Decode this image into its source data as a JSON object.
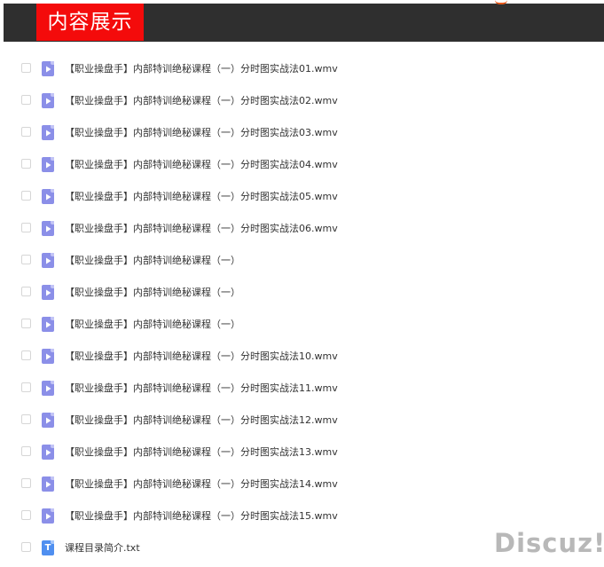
{
  "header": {
    "title": "内容展示",
    "bar_color": "#2f2f2f",
    "title_bg_color": "#f40b0b"
  },
  "files": [
    {
      "name": "【职业操盘手】内部特训绝秘课程（一）分时图实战法01.wmv",
      "icon": "video-file-icon"
    },
    {
      "name": "【职业操盘手】内部特训绝秘课程（一）分时图实战法02.wmv",
      "icon": "video-file-icon"
    },
    {
      "name": "【职业操盘手】内部特训绝秘课程（一）分时图实战法03.wmv",
      "icon": "video-file-icon"
    },
    {
      "name": "【职业操盘手】内部特训绝秘课程（一）分时图实战法04.wmv",
      "icon": "video-file-icon"
    },
    {
      "name": "【职业操盘手】内部特训绝秘课程（一）分时图实战法05.wmv",
      "icon": "video-file-icon"
    },
    {
      "name": "【职业操盘手】内部特训绝秘课程（一）分时图实战法06.wmv",
      "icon": "video-file-icon"
    },
    {
      "name": "【职业操盘手】内部特训绝秘课程（一）",
      "icon": "video-file-icon"
    },
    {
      "name": "【职业操盘手】内部特训绝秘课程（一）",
      "icon": "video-file-icon"
    },
    {
      "name": "【职业操盘手】内部特训绝秘课程（一）",
      "icon": "video-file-icon"
    },
    {
      "name": "【职业操盘手】内部特训绝秘课程（一）分时图实战法10.wmv",
      "icon": "video-file-icon"
    },
    {
      "name": "【职业操盘手】内部特训绝秘课程（一）分时图实战法11.wmv",
      "icon": "video-file-icon"
    },
    {
      "name": "【职业操盘手】内部特训绝秘课程（一）分时图实战法12.wmv",
      "icon": "video-file-icon"
    },
    {
      "name": "【职业操盘手】内部特训绝秘课程（一）分时图实战法13.wmv",
      "icon": "video-file-icon"
    },
    {
      "name": "【职业操盘手】内部特训绝秘课程（一）分时图实战法14.wmv",
      "icon": "video-file-icon"
    },
    {
      "name": "【职业操盘手】内部特训绝秘课程（一）分时图实战法15.wmv",
      "icon": "video-file-icon"
    },
    {
      "name": "课程目录简介.txt",
      "icon": "text-file-icon",
      "glyph": "T"
    }
  ],
  "video_icon_color": "#8b8fe8",
  "text_icon_color": "#4f8ff0",
  "watermark": "Discuz!"
}
